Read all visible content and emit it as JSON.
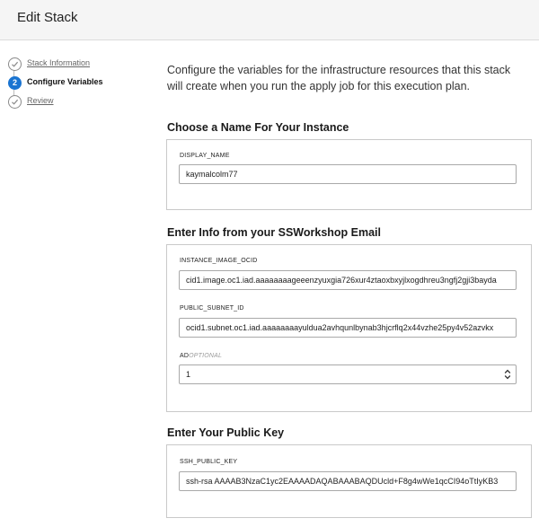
{
  "header": {
    "title": "Edit Stack"
  },
  "steps": [
    {
      "number": "",
      "label": "Stack Information"
    },
    {
      "number": "2",
      "label": "Configure Variables"
    },
    {
      "number": "",
      "label": "Review"
    }
  ],
  "intro": "Configure the variables for the infrastructure resources that this stack will create when you run the apply job for this execution plan.",
  "sections": {
    "instance": {
      "title": "Choose a Name For Your Instance",
      "display_name_label": "DISPLAY_NAME",
      "display_name_value": "kaymalcolm77"
    },
    "ssworkshop": {
      "title": "Enter Info from your SSWorkshop Email",
      "image_label": "INSTANCE_IMAGE_OCID",
      "image_value": "cid1.image.oc1.iad.aaaaaaaageeenzyuxgia726xur4ztaoxbxyjlxogdhreu3ngfj2gji3bayda",
      "subnet_label": "PUBLIC_SUBNET_ID",
      "subnet_value": "ocid1.subnet.oc1.iad.aaaaaaaayuldua2avhqunlbynab3hjcrflq2x44vzhe25py4v52azvkx",
      "ad_label": "AD",
      "ad_optional": "OPTIONAL",
      "ad_value": "1"
    },
    "publickey": {
      "title": "Enter Your Public Key",
      "ssh_label": "SSH_PUBLIC_KEY",
      "ssh_value": "ssh-rsa AAAAB3NzaC1yc2EAAAADAQABAAABAQDUcld+F8g4wWe1qcCI94oTtIyKB3"
    }
  },
  "colors": {
    "accent": "#1a74d1",
    "header_bg": "#f5f5f5"
  },
  "icons": {
    "completed_step": "check-circle-icon",
    "select_arrow": "up-down-chevron-icon"
  }
}
